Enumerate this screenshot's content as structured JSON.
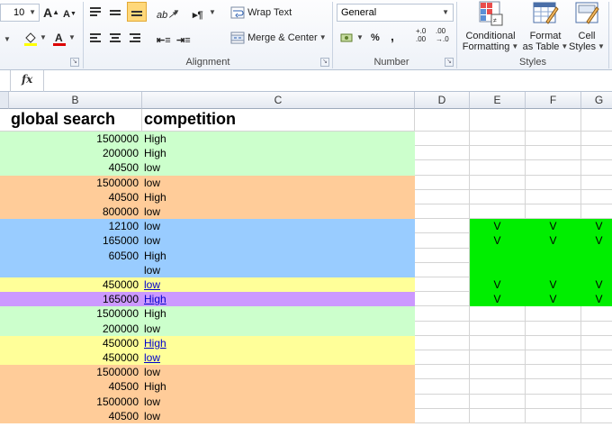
{
  "ribbon": {
    "font_size": "10",
    "wrap_text": "Wrap Text",
    "merge_center": "Merge & Center",
    "number_format": "General",
    "percent": "%",
    "comma": ",",
    "inc_decimal": "+.0\n.00",
    "dec_decimal": ".00\n→.0",
    "conditional_formatting_l1": "Conditional",
    "conditional_formatting_l2": "Formatting",
    "format_as_table_l1": "Format",
    "format_as_table_l2": "as Table",
    "cell_styles_l1": "Cell",
    "cell_styles_l2": "Styles",
    "groups": {
      "alignment": "Alignment",
      "number": "Number",
      "styles": "Styles"
    }
  },
  "formula_bar": {
    "fx": "fx",
    "value": ""
  },
  "columns": [
    "B",
    "C",
    "D",
    "E",
    "F",
    "G"
  ],
  "header_row": {
    "b": "global search",
    "c": "competition"
  },
  "rows": [
    {
      "b": "1500000",
      "c": "High",
      "fill": "#ccffcc",
      "link": false,
      "v": false
    },
    {
      "b": "200000",
      "c": "High",
      "fill": "#ccffcc",
      "link": false,
      "v": false
    },
    {
      "b": "40500",
      "c": "low",
      "fill": "#ccffcc",
      "link": false,
      "v": false
    },
    {
      "b": "1500000",
      "c": "low",
      "fill": "#ffcc99",
      "link": false,
      "v": false
    },
    {
      "b": "40500",
      "c": "High",
      "fill": "#ffcc99",
      "link": false,
      "v": false
    },
    {
      "b": "800000",
      "c": "low",
      "fill": "#ffcc99",
      "link": false,
      "v": false
    },
    {
      "b": "12100",
      "c": "low",
      "fill": "#99ccff",
      "link": false,
      "v": true,
      "vtext": "V"
    },
    {
      "b": "165000",
      "c": "low",
      "fill": "#99ccff",
      "link": false,
      "v": true,
      "vtext": "V"
    },
    {
      "b": "60500",
      "c": "High",
      "fill": "#99ccff",
      "link": false,
      "v": true,
      "vtext": ""
    },
    {
      "b": "",
      "c": "low",
      "fill": "#99ccff",
      "link": false,
      "v": true,
      "vtext": ""
    },
    {
      "b": "450000",
      "c": "low",
      "fill": "#ffff99",
      "link": true,
      "v": true,
      "vtext": "V"
    },
    {
      "b": "165000",
      "c": "High",
      "fill": "#cc99ff",
      "link": true,
      "v": true,
      "vtext": "V"
    },
    {
      "b": "1500000",
      "c": "High",
      "fill": "#ccffcc",
      "link": false,
      "v": false
    },
    {
      "b": "200000",
      "c": "low",
      "fill": "#ccffcc",
      "link": false,
      "v": false
    },
    {
      "b": "450000",
      "c": "High",
      "fill": "#ffff99",
      "link": true,
      "v": false
    },
    {
      "b": "450000",
      "c": "low",
      "fill": "#ffff99",
      "link": true,
      "v": false
    },
    {
      "b": "1500000",
      "c": "low",
      "fill": "#ffcc99",
      "link": false,
      "v": false
    },
    {
      "b": "40500",
      "c": "High",
      "fill": "#ffcc99",
      "link": false,
      "v": false
    },
    {
      "b": "1500000",
      "c": "low",
      "fill": "#ffcc99",
      "link": false,
      "v": false
    },
    {
      "b": "40500",
      "c": "low",
      "fill": "#ffcc99",
      "link": false,
      "v": false
    }
  ],
  "colors": {
    "v_block": "#00ee00",
    "link": "#0000cc"
  }
}
